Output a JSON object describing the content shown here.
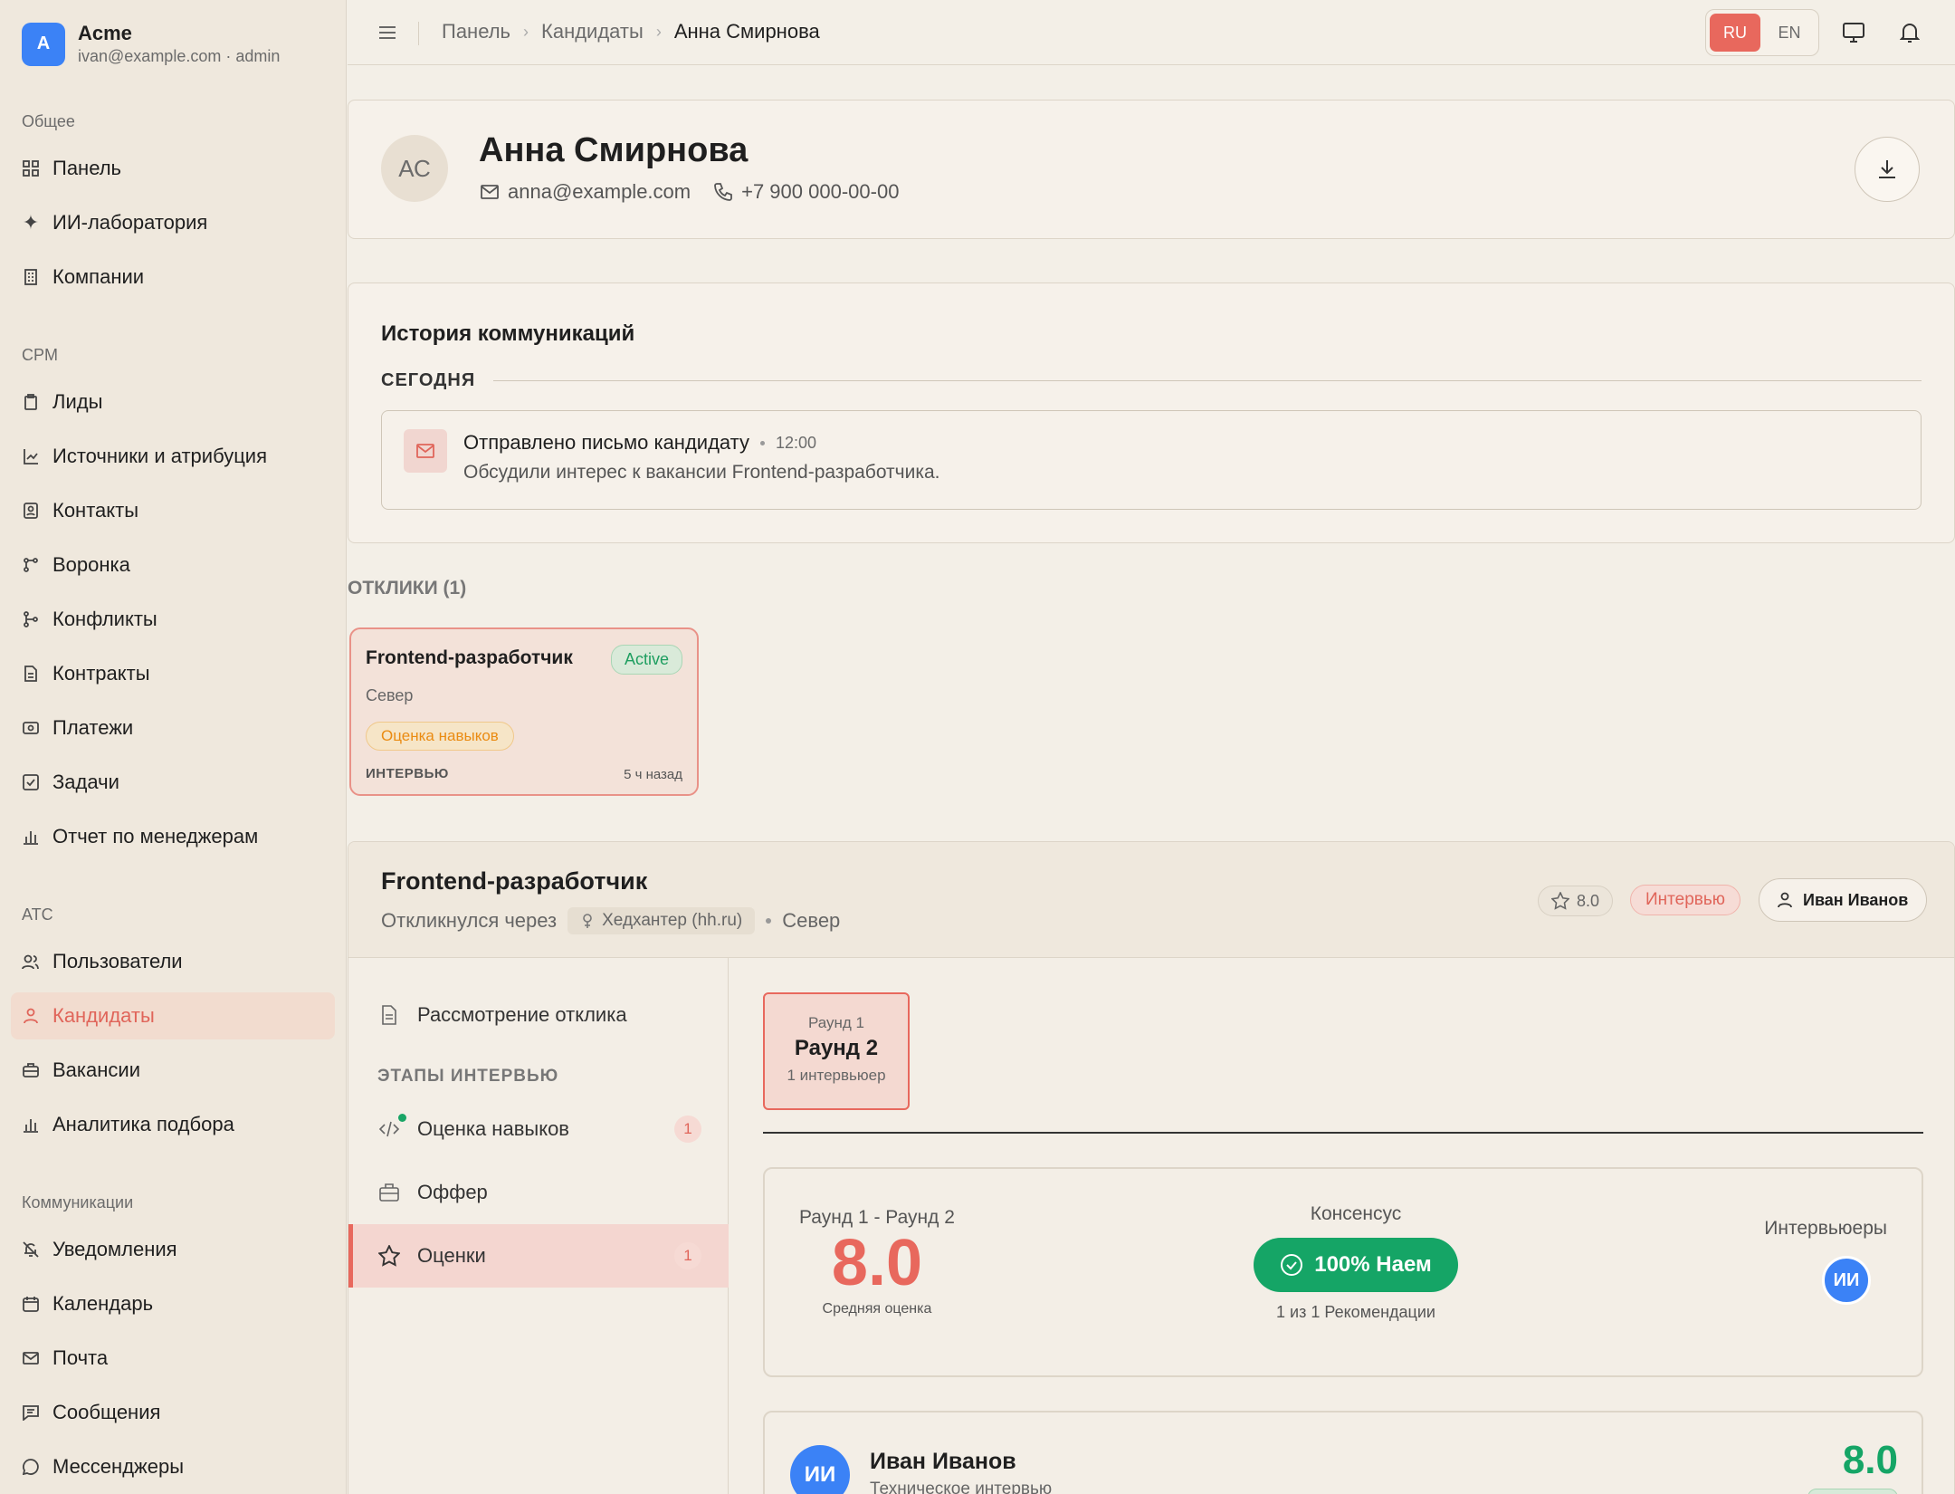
{
  "brand": {
    "initial": "A",
    "name": "Acme",
    "subtitle": "ivan@example.com · admin"
  },
  "sidebar": {
    "sections": [
      {
        "label": "Общее"
      },
      {
        "label": "CPM"
      },
      {
        "label": "ATC"
      },
      {
        "label": "Коммуникации"
      }
    ],
    "items": [
      {
        "label": "Панель",
        "icon": "dashboard-icon"
      },
      {
        "label": "ИИ-лаборатория",
        "icon": "sparkles-icon"
      },
      {
        "label": "Компании",
        "icon": "building-icon"
      },
      {
        "label": "Лиды",
        "icon": "clipboard-icon"
      },
      {
        "label": "Источники и атрибуция",
        "icon": "chart-line-icon"
      },
      {
        "label": "Контакты",
        "icon": "contact-icon"
      },
      {
        "label": "Воронка",
        "icon": "funnel-icon"
      },
      {
        "label": "Конфликты",
        "icon": "git-branch-icon"
      },
      {
        "label": "Контракты",
        "icon": "document-icon"
      },
      {
        "label": "Платежи",
        "icon": "banknote-icon"
      },
      {
        "label": "Задачи",
        "icon": "checkbox-icon"
      },
      {
        "label": "Отчет по менеджерам",
        "icon": "bar-chart-icon"
      },
      {
        "label": "Пользователи",
        "icon": "users-icon"
      },
      {
        "label": "Кандидаты",
        "icon": "user-icon"
      },
      {
        "label": "Вакансии",
        "icon": "briefcase-icon"
      },
      {
        "label": "Аналитика подбора",
        "icon": "bar-chart-icon"
      },
      {
        "label": "Уведомления",
        "icon": "bell-off-icon"
      },
      {
        "label": "Календарь",
        "icon": "calendar-icon"
      },
      {
        "label": "Почта",
        "icon": "mail-icon"
      },
      {
        "label": "Сообщения",
        "icon": "message-icon"
      },
      {
        "label": "Мессенджеры",
        "icon": "chat-icon"
      }
    ]
  },
  "topbar": {
    "breadcrumb": [
      "Панель",
      "Кандидаты",
      "Анна Смирнова"
    ],
    "lang": {
      "ru": "RU",
      "en": "EN",
      "active": "RU"
    }
  },
  "profile": {
    "initials": "АС",
    "name": "Анна Смирнова",
    "email": "anna@example.com",
    "phone": "+7 900 000-00-00"
  },
  "history": {
    "title": "История коммуникаций",
    "group": "СЕГОДНЯ",
    "event": {
      "title": "Отправлено письмо кандидату",
      "time": "12:00",
      "description": "Обсудили интерес к вакансии Frontend-разработчика."
    }
  },
  "applications": {
    "label": "ОТКЛИКИ (1)",
    "card": {
      "title": "Frontend-разработчик",
      "status": "Active",
      "location": "Север",
      "tag": "Оценка навыков",
      "stage": "ИНТЕРВЬЮ",
      "time": "5 ч назад"
    }
  },
  "vacancy": {
    "title": "Frontend-разработчик",
    "applied_via": "Откликнулся через",
    "source": "Хедхантер (hh.ru)",
    "location": "Север",
    "rating": "8.0",
    "stage": "Интервью",
    "owner": "Иван Иванов",
    "steps": {
      "review": "Рассмотрение отклика",
      "section_label": "ЭТАПЫ ИНТЕРВЬЮ",
      "items": [
        {
          "label": "Оценка навыков",
          "count": "1"
        },
        {
          "label": "Оффер",
          "count": ""
        },
        {
          "label": "Оценки",
          "count": "1"
        }
      ]
    },
    "round_tab": {
      "subtitle": "Раунд 1",
      "title": "Раунд 2",
      "interviewers": "1 интервьюер"
    },
    "summary": {
      "range": "Раунд 1 - Раунд 2",
      "score": "8.0",
      "score_caption": "Средняя оценка",
      "consensus_label": "Консенсус",
      "consensus_value": "100% Наем",
      "recommendations": "1 из 1 Рекомендации",
      "interviewers_label": "Интервьюеры",
      "interviewer_initials": "ИИ"
    },
    "review": {
      "initials": "ИИ",
      "name": "Иван Иванов",
      "role": "Техническое интервью",
      "score": "8.0"
    }
  }
}
